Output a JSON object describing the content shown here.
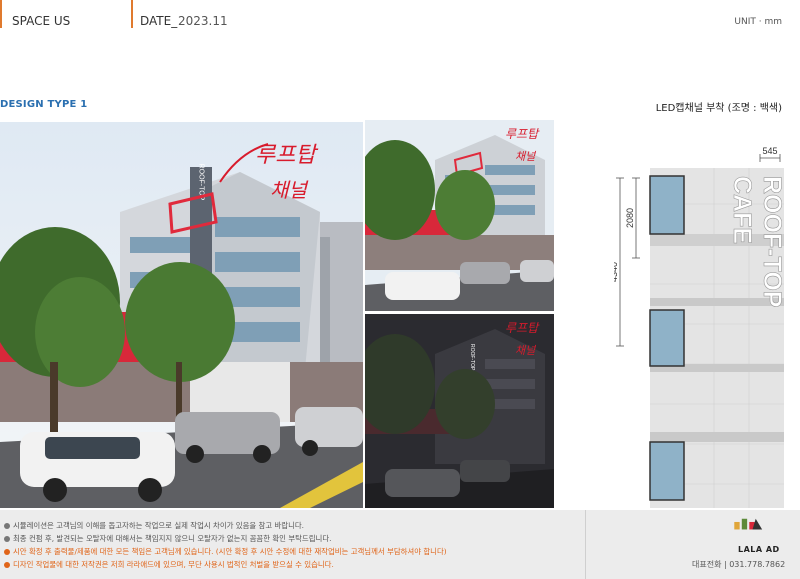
{
  "header": {
    "project": "SPACE US",
    "date_label": "DATE_",
    "date_value": "2023.11",
    "unit": "UNIT · mm"
  },
  "design_type": "DESIGN TYPE 1",
  "right_title": "LED캡채널 부착 (조명 : 백색)",
  "sign_text": {
    "line1": "ROOF-TOP",
    "line2": "CAFE"
  },
  "handwriting": {
    "line1": "루프탑",
    "line2": "채널"
  },
  "dimensions": {
    "width": "545",
    "letter_height": "2080",
    "total_height": "4340"
  },
  "notes": [
    {
      "text": "시뮬레이션은 고객님의 이해를 돕고자하는 작업으로 실제 작업시 차이가 있음을 참고 바랍니다.",
      "warn": false
    },
    {
      "text": "최종 컨펌 후, 발견되는 오탈자에 대해서는 책임지지 않으니 오탈자가 없는지 꼼꼼한 확인 부탁드립니다.",
      "warn": false
    },
    {
      "text": "시안 확정 후 출력물/제품에 대한 모든 책임은 고객님께 있습니다. (시안 확정 후 시안 수정에 대한 재작업비는 고객님께서 부담하셔야 합니다)",
      "warn": true
    },
    {
      "text": "디자인 작업물에 대한 저작권은 저희 라라애드에 있으며, 무단 사용시 법적인 처벌을 받으실 수 있습니다.",
      "warn": true
    }
  ],
  "company": {
    "logo": "LALA AD",
    "phone": "대표전화 | 031.778.7862"
  },
  "colors": {
    "accent": "#e07a2e",
    "heading_blue": "#2a6fb0",
    "warn": "#e06418",
    "window_blue": "#8fb2c8",
    "sign_red": "#e02a3c"
  }
}
